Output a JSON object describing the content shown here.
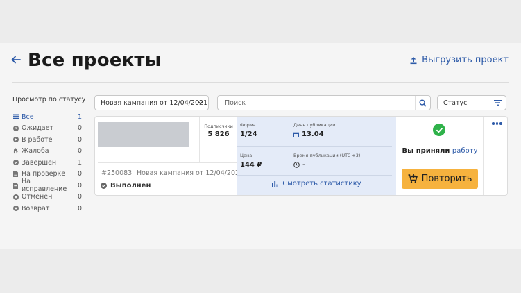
{
  "header": {
    "title": "Все проекты",
    "export_label": "Выгрузить проект"
  },
  "sidebar": {
    "title": "Просмотр по статусу",
    "items": [
      {
        "label": "Все",
        "count": "1",
        "icon": "list-icon",
        "active": true
      },
      {
        "label": "Ожидает",
        "count": "0",
        "icon": "clock-icon"
      },
      {
        "label": "В работе",
        "count": "0",
        "icon": "play-icon"
      },
      {
        "label": "Жалоба",
        "count": "0",
        "icon": "hand-icon"
      },
      {
        "label": "Завершен",
        "count": "1",
        "icon": "check-icon"
      },
      {
        "label": "На проверке",
        "count": "0",
        "icon": "document-icon"
      },
      {
        "label": "На исправление",
        "count": "0",
        "icon": "document-icon"
      },
      {
        "label": "Отменен",
        "count": "0",
        "icon": "cancel-icon"
      },
      {
        "label": "Возврат",
        "count": "0",
        "icon": "cancel-icon"
      }
    ]
  },
  "filters": {
    "campaign_value": "Новая кампания от 12/04/2021",
    "search_placeholder": "Поиск",
    "status_value": "Статус"
  },
  "card": {
    "subscribers_label": "Подписчики",
    "subscribers_value": "5 826",
    "order_id": "#250083",
    "order_name": "Новая кампания от 12/04/2021",
    "status": "Выполнен",
    "format_label": "Формат",
    "format_value": "1/24",
    "publish_day_label": "День публикации",
    "publish_day_value": "13.04",
    "price_label": "Цена",
    "price_value": "144 ₽",
    "publish_time_label": "Время публикации (UTC +3)",
    "publish_time_value": "-",
    "stats_link": "Смотреть статистику",
    "accepted_text": "Вы приняли",
    "accepted_link": "работу",
    "repeat_label": "Повторить"
  },
  "colors": {
    "accent": "#2d5aa8",
    "success": "#2fb24a",
    "button": "#f6b23e",
    "stats_bg": "#e4ebf8"
  }
}
